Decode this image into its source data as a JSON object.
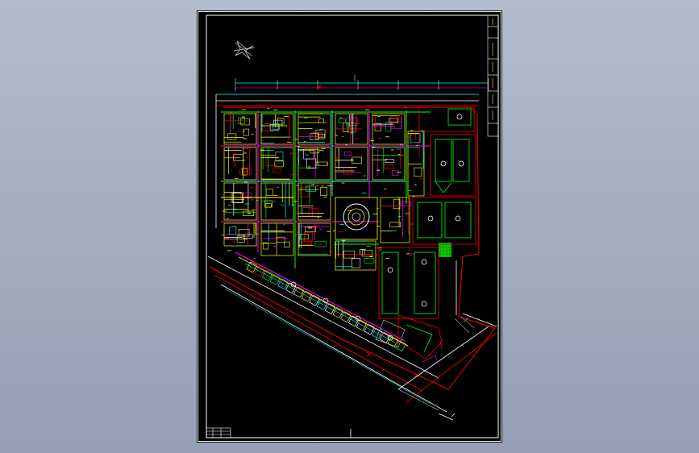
{
  "viewer": {
    "background_top": "#b3bccb",
    "background_bottom": "#959fb4"
  },
  "drawing": {
    "sheet_color": "#000000",
    "frame_color": "#ffffff",
    "palette": {
      "yellow": "#ffff00",
      "magenta": "#ff00ff",
      "green": "#00ff00",
      "cyan": "#00ffff",
      "red": "#ff0000",
      "white": "#ffffff"
    },
    "elements": {
      "north_arrow": "north-arrow-icon",
      "plaza": "circular-plaza",
      "title_block": "title-block-table",
      "revision_strip": "revision-strip"
    }
  }
}
